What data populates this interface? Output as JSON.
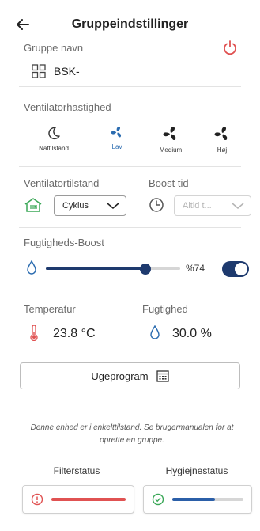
{
  "header": {
    "title": "Gruppeindstillinger"
  },
  "group_name": {
    "label": "Gruppe navn",
    "value": "BSK-"
  },
  "fan_speed": {
    "label": "Ventilatorhastighed",
    "items": [
      {
        "label": "Nattilstand",
        "icon": "moon-icon",
        "active": false
      },
      {
        "label": "Lav",
        "icon": "fan-icon",
        "active": true
      },
      {
        "label": "Medium",
        "icon": "fan-icon",
        "active": false
      },
      {
        "label": "Høj",
        "icon": "fan-icon",
        "active": false
      }
    ]
  },
  "fan_mode": {
    "label": "Ventilatortilstand",
    "value": "Cyklus"
  },
  "boost_time": {
    "label": "Boost tid",
    "value": "Altid t..."
  },
  "humidity_boost": {
    "label": "Fugtigheds-Boost",
    "value": "%74",
    "level": 0.74,
    "enabled": true
  },
  "temperature": {
    "label": "Temperatur",
    "value": "23.8 °C"
  },
  "humidity": {
    "label": "Fugtighed",
    "value": "30.0 %"
  },
  "week_program": {
    "label": "Ugeprogram"
  },
  "info": {
    "text": "Denne enhed er i enkelttilstand. Se brugermanualen for at oprette en gruppe."
  },
  "filter_status": {
    "label": "Filterstatus",
    "state": "warning",
    "color": "#e05252"
  },
  "hygiene_status": {
    "label": "Hygiejnestatus",
    "state": "ok",
    "level": 0.6,
    "color": "#2b5fa8"
  },
  "colors": {
    "accent": "#1e3a6e",
    "red": "#e05252",
    "blue": "#2b6cb0",
    "green": "#3aa757"
  }
}
